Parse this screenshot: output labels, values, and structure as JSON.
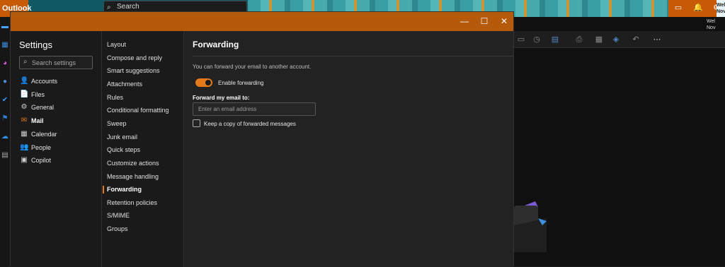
{
  "app": {
    "name": "Outlook",
    "search_label": "Search",
    "welcome_line1": "Wel",
    "welcome_line2": "Nov"
  },
  "settings": {
    "title": "Settings",
    "search_placeholder": "Search settings",
    "categories": [
      {
        "label": "Accounts",
        "icon": "person-icon",
        "glyph": "👤",
        "selected": false
      },
      {
        "label": "Files",
        "icon": "file-icon",
        "glyph": "📄",
        "selected": false
      },
      {
        "label": "General",
        "icon": "gear-icon",
        "glyph": "⚙",
        "selected": false
      },
      {
        "label": "Mail",
        "icon": "mail-icon",
        "glyph": "✉",
        "selected": true
      },
      {
        "label": "Calendar",
        "icon": "calendar-icon",
        "glyph": "▦",
        "selected": false
      },
      {
        "label": "People",
        "icon": "people-icon",
        "glyph": "👥",
        "selected": false
      },
      {
        "label": "Copilot",
        "icon": "copilot-icon",
        "glyph": "▣",
        "selected": false
      }
    ],
    "mail_sections": [
      "Layout",
      "Compose and reply",
      "Smart suggestions",
      "Attachments",
      "Rules",
      "Conditional formatting",
      "Sweep",
      "Junk email",
      "Quick steps",
      "Customize actions",
      "Message handling",
      "Forwarding",
      "Retention policies",
      "S/MIME",
      "Groups"
    ],
    "selected_section": "Forwarding"
  },
  "forwarding": {
    "title": "Forwarding",
    "description": "You can forward your email to another account.",
    "enable_label": "Enable forwarding",
    "enabled": true,
    "forward_to_label": "Forward my email to:",
    "email_placeholder": "Enter an email address",
    "email_value": "",
    "keep_copy_label": "Keep a copy of forwarded messages",
    "keep_copy": false
  },
  "colors": {
    "accent": "#e47a1a",
    "titlebar": "#b55a0a",
    "panel": "#222222"
  }
}
